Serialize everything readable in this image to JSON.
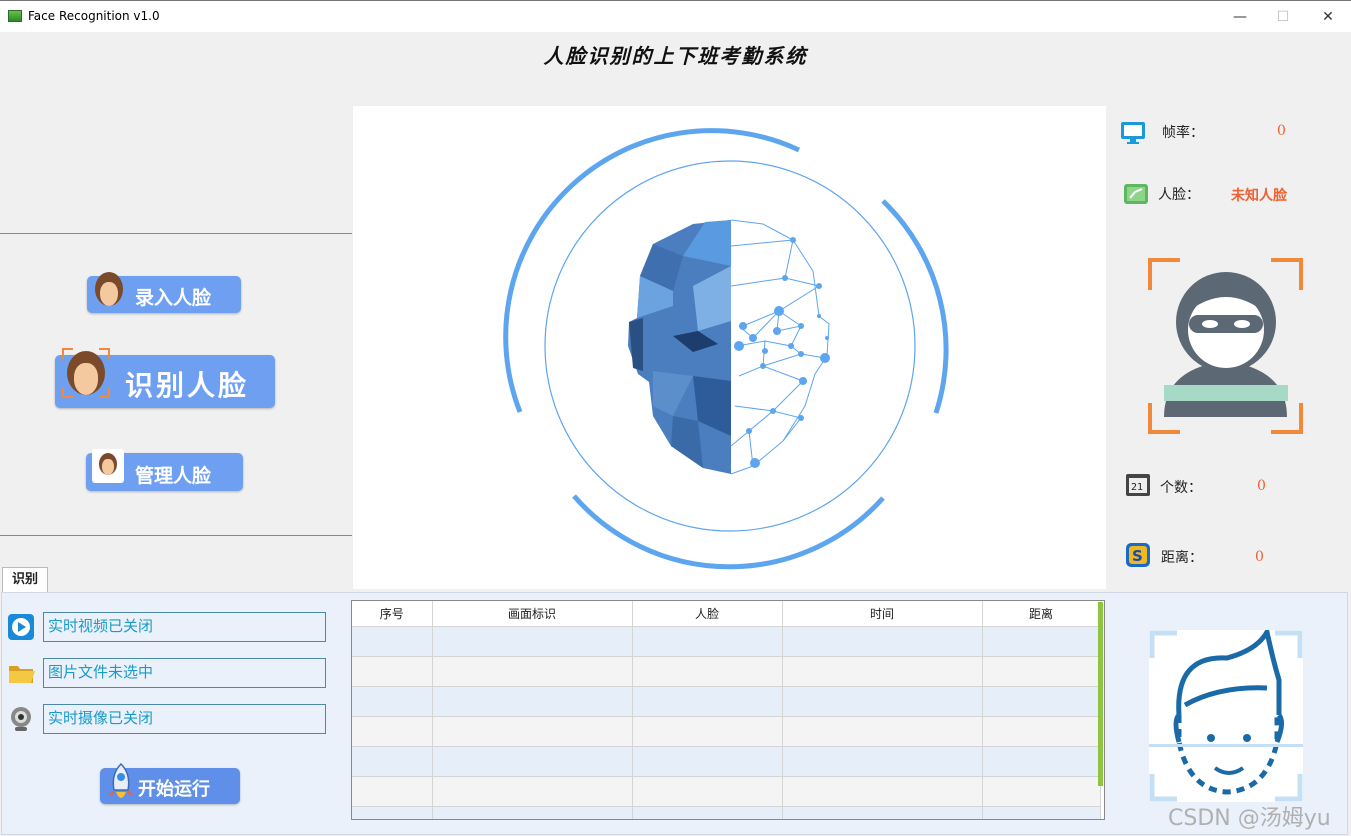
{
  "window": {
    "title": "Face Recognition v1.0",
    "minimize": "—",
    "maximize": "☐",
    "close": "✕"
  },
  "header": {
    "title": "人脸识别的上下班考勤系统"
  },
  "sidebar": {
    "enroll_label": "录入人脸",
    "recognize_label": "识别人脸",
    "manage_label": "管理人脸"
  },
  "info": {
    "fps_label": "帧率：",
    "fps_value": "0",
    "face_label": "人脸：",
    "face_value": "未知人脸",
    "count_label": "个数：",
    "count_value": "0",
    "distance_label": "距离：",
    "distance_value": "0"
  },
  "tabs": {
    "recognize": "识别"
  },
  "status": {
    "video": "实时视频已关闭",
    "image": "图片文件未选中",
    "camera": "实时摄像已关闭",
    "start_label": "开始运行"
  },
  "table": {
    "headers": [
      "序号",
      "画面标识",
      "人脸",
      "时间",
      "距离"
    ]
  },
  "watermark": "CSDN @汤姆yu",
  "colors": {
    "accent_blue": "#5ea5ef",
    "button_blue": "#6e9ff0",
    "value_orange": "#f06030",
    "frame_orange": "#f08a3a"
  }
}
